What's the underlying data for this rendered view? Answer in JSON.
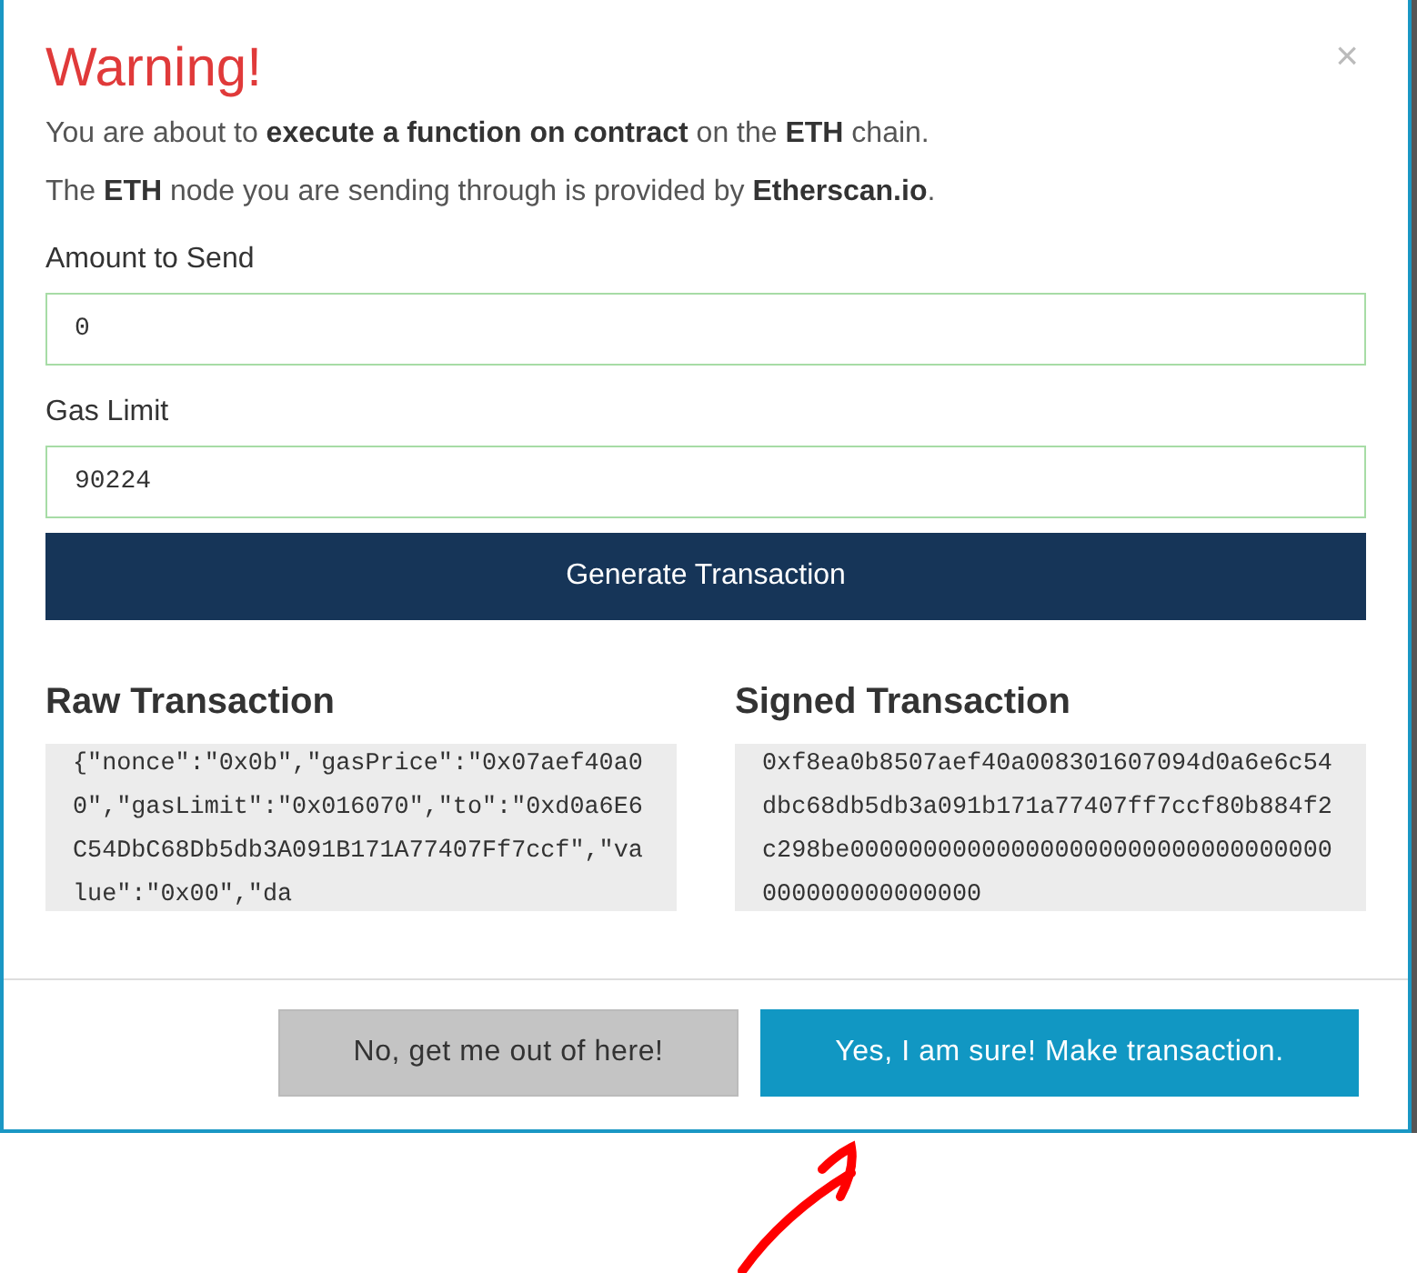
{
  "dialog": {
    "title": "Warning!",
    "close": "×",
    "messages": [
      "You are about to **execute a function on contract** on the **ETH** chain.",
      "The **ETH** node you are sending through is provided by **Etherscan.io**."
    ],
    "fields": [
      {
        "label": "Amount to Send",
        "value": "0"
      },
      {
        "label": "Gas Limit",
        "value": "90224"
      }
    ],
    "generate_button": "Generate Transaction",
    "transactions": [
      {
        "heading": "Raw Transaction",
        "value": "{\"nonce\":\"0x0b\",\"gasPrice\":\"0x07aef40a00\",\"gasLimit\":\"0x016070\",\"to\":\"0xd0a6E6C54DbC68Db5db3A091B171A77407Ff7ccf\",\"value\":\"0x00\",\"da"
      },
      {
        "heading": "Signed Transaction",
        "value": "0xf8ea0b8507aef40a008301607094d0a6e6c54dbc68db5db3a091b171a77407ff7ccf80b884f2c298be000000000000000000000000000000000000000000000000"
      }
    ],
    "buttons": [
      {
        "label": "No, get me out of here!",
        "kind": "cancel"
      },
      {
        "label": "Yes, I am sure! Make transaction.",
        "kind": "confirm"
      }
    ]
  }
}
